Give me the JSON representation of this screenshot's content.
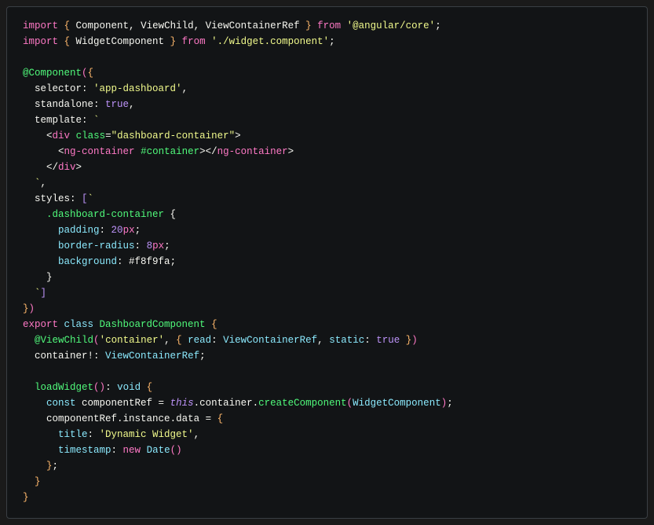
{
  "code": {
    "lines": [
      [
        {
          "t": "import ",
          "c": "kw"
        },
        {
          "t": "{ ",
          "c": "brace"
        },
        {
          "t": "Component",
          "c": "ident"
        },
        {
          "t": ", ",
          "c": "punct"
        },
        {
          "t": "ViewChild",
          "c": "ident"
        },
        {
          "t": ", ",
          "c": "punct"
        },
        {
          "t": "ViewContainerRef",
          "c": "ident"
        },
        {
          "t": " }",
          "c": "brace"
        },
        {
          "t": " from ",
          "c": "kw"
        },
        {
          "t": "'@angular/core'",
          "c": "str"
        },
        {
          "t": ";",
          "c": "punct"
        }
      ],
      [
        {
          "t": "import ",
          "c": "kw"
        },
        {
          "t": "{ ",
          "c": "brace"
        },
        {
          "t": "WidgetComponent",
          "c": "ident"
        },
        {
          "t": " }",
          "c": "brace"
        },
        {
          "t": " from ",
          "c": "kw"
        },
        {
          "t": "'./widget.component'",
          "c": "str"
        },
        {
          "t": ";",
          "c": "punct"
        }
      ],
      [],
      [
        {
          "t": "@",
          "c": "decor"
        },
        {
          "t": "Component",
          "c": "decor"
        },
        {
          "t": "(",
          "c": "brace2"
        },
        {
          "t": "{",
          "c": "brace"
        }
      ],
      [
        {
          "t": "  selector",
          "c": "prop"
        },
        {
          "t": ": ",
          "c": "punct"
        },
        {
          "t": "'app-dashboard'",
          "c": "str"
        },
        {
          "t": ",",
          "c": "punct"
        }
      ],
      [
        {
          "t": "  standalone",
          "c": "prop"
        },
        {
          "t": ": ",
          "c": "punct"
        },
        {
          "t": "true",
          "c": "bool"
        },
        {
          "t": ",",
          "c": "punct"
        }
      ],
      [
        {
          "t": "  template",
          "c": "prop"
        },
        {
          "t": ": ",
          "c": "punct"
        },
        {
          "t": "`",
          "c": "str"
        }
      ],
      [
        {
          "t": "    ",
          "c": "str"
        },
        {
          "t": "<",
          "c": "ang"
        },
        {
          "t": "div",
          "c": "tag"
        },
        {
          "t": " ",
          "c": "str"
        },
        {
          "t": "class",
          "c": "attr"
        },
        {
          "t": "=",
          "c": "punct"
        },
        {
          "t": "\"dashboard-container\"",
          "c": "str"
        },
        {
          "t": ">",
          "c": "ang"
        }
      ],
      [
        {
          "t": "      ",
          "c": "str"
        },
        {
          "t": "<",
          "c": "ang"
        },
        {
          "t": "ng-container",
          "c": "tag"
        },
        {
          "t": " ",
          "c": "str"
        },
        {
          "t": "#container",
          "c": "attr"
        },
        {
          "t": ">",
          "c": "ang"
        },
        {
          "t": "</",
          "c": "ang"
        },
        {
          "t": "ng-container",
          "c": "tag"
        },
        {
          "t": ">",
          "c": "ang"
        }
      ],
      [
        {
          "t": "    ",
          "c": "str"
        },
        {
          "t": "</",
          "c": "ang"
        },
        {
          "t": "div",
          "c": "tag"
        },
        {
          "t": ">",
          "c": "ang"
        }
      ],
      [
        {
          "t": "  `",
          "c": "str"
        },
        {
          "t": ",",
          "c": "punct"
        }
      ],
      [
        {
          "t": "  styles",
          "c": "prop"
        },
        {
          "t": ": ",
          "c": "punct"
        },
        {
          "t": "[",
          "c": "brack"
        },
        {
          "t": "`",
          "c": "str"
        }
      ],
      [
        {
          "t": "    ",
          "c": "str"
        },
        {
          "t": ".dashboard-container",
          "c": "css-sel"
        },
        {
          "t": " {",
          "c": "punct"
        }
      ],
      [
        {
          "t": "      ",
          "c": "str"
        },
        {
          "t": "padding",
          "c": "css-prop"
        },
        {
          "t": ": ",
          "c": "punct"
        },
        {
          "t": "20",
          "c": "css-val"
        },
        {
          "t": "px",
          "c": "css-unit"
        },
        {
          "t": ";",
          "c": "punct"
        }
      ],
      [
        {
          "t": "      ",
          "c": "str"
        },
        {
          "t": "border-radius",
          "c": "css-prop"
        },
        {
          "t": ": ",
          "c": "punct"
        },
        {
          "t": "8",
          "c": "css-val"
        },
        {
          "t": "px",
          "c": "css-unit"
        },
        {
          "t": ";",
          "c": "punct"
        }
      ],
      [
        {
          "t": "      ",
          "c": "str"
        },
        {
          "t": "background",
          "c": "css-prop"
        },
        {
          "t": ": ",
          "c": "punct"
        },
        {
          "t": "#f8f9fa",
          "c": "css-hex"
        },
        {
          "t": ";",
          "c": "punct"
        }
      ],
      [
        {
          "t": "    }",
          "c": "punct"
        }
      ],
      [
        {
          "t": "  `",
          "c": "str"
        },
        {
          "t": "]",
          "c": "brack"
        }
      ],
      [
        {
          "t": "}",
          "c": "brace"
        },
        {
          "t": ")",
          "c": "brace2"
        }
      ],
      [
        {
          "t": "export ",
          "c": "kw"
        },
        {
          "t": "class ",
          "c": "kw2"
        },
        {
          "t": "DashboardComponent",
          "c": "decor"
        },
        {
          "t": " {",
          "c": "brace"
        }
      ],
      [
        {
          "t": "  ",
          "c": "punct"
        },
        {
          "t": "@",
          "c": "decor"
        },
        {
          "t": "ViewChild",
          "c": "decor"
        },
        {
          "t": "(",
          "c": "brace2"
        },
        {
          "t": "'container'",
          "c": "str"
        },
        {
          "t": ", ",
          "c": "punct"
        },
        {
          "t": "{ ",
          "c": "brace"
        },
        {
          "t": "read",
          "c": "propk"
        },
        {
          "t": ": ",
          "c": "punct"
        },
        {
          "t": "ViewContainerRef",
          "c": "type"
        },
        {
          "t": ", ",
          "c": "punct"
        },
        {
          "t": "static",
          "c": "propk"
        },
        {
          "t": ": ",
          "c": "punct"
        },
        {
          "t": "true",
          "c": "bool"
        },
        {
          "t": " }",
          "c": "brace"
        },
        {
          "t": ")",
          "c": "brace2"
        }
      ],
      [
        {
          "t": "  container",
          "c": "ident"
        },
        {
          "t": "!:",
          "c": "punct"
        },
        {
          "t": " ",
          "c": "punct"
        },
        {
          "t": "ViewContainerRef",
          "c": "type"
        },
        {
          "t": ";",
          "c": "punct"
        }
      ],
      [],
      [
        {
          "t": "  ",
          "c": "punct"
        },
        {
          "t": "loadWidget",
          "c": "meth"
        },
        {
          "t": "(",
          "c": "brace2"
        },
        {
          "t": ")",
          "c": "brace2"
        },
        {
          "t": ": ",
          "c": "punct"
        },
        {
          "t": "void",
          "c": "type"
        },
        {
          "t": " {",
          "c": "brace"
        }
      ],
      [
        {
          "t": "    ",
          "c": "punct"
        },
        {
          "t": "const ",
          "c": "kw2"
        },
        {
          "t": "componentRef",
          "c": "ident"
        },
        {
          "t": " = ",
          "c": "punct"
        },
        {
          "t": "this",
          "c": "this"
        },
        {
          "t": ".",
          "c": "punct"
        },
        {
          "t": "container",
          "c": "ident"
        },
        {
          "t": ".",
          "c": "punct"
        },
        {
          "t": "createComponent",
          "c": "meth"
        },
        {
          "t": "(",
          "c": "brace2"
        },
        {
          "t": "WidgetComponent",
          "c": "type"
        },
        {
          "t": ")",
          "c": "brace2"
        },
        {
          "t": ";",
          "c": "punct"
        }
      ],
      [
        {
          "t": "    componentRef",
          "c": "ident"
        },
        {
          "t": ".",
          "c": "punct"
        },
        {
          "t": "instance",
          "c": "ident"
        },
        {
          "t": ".",
          "c": "punct"
        },
        {
          "t": "data",
          "c": "ident"
        },
        {
          "t": " = ",
          "c": "punct"
        },
        {
          "t": "{",
          "c": "brace"
        }
      ],
      [
        {
          "t": "      title",
          "c": "propk"
        },
        {
          "t": ": ",
          "c": "punct"
        },
        {
          "t": "'Dynamic Widget'",
          "c": "str"
        },
        {
          "t": ",",
          "c": "punct"
        }
      ],
      [
        {
          "t": "      timestamp",
          "c": "propk"
        },
        {
          "t": ": ",
          "c": "punct"
        },
        {
          "t": "new ",
          "c": "kw"
        },
        {
          "t": "Date",
          "c": "type"
        },
        {
          "t": "(",
          "c": "brace2"
        },
        {
          "t": ")",
          "c": "brace2"
        }
      ],
      [
        {
          "t": "    ",
          "c": "punct"
        },
        {
          "t": "}",
          "c": "brace"
        },
        {
          "t": ";",
          "c": "punct"
        }
      ],
      [
        {
          "t": "  ",
          "c": "punct"
        },
        {
          "t": "}",
          "c": "brace"
        }
      ],
      [
        {
          "t": "}",
          "c": "brace"
        }
      ]
    ]
  }
}
